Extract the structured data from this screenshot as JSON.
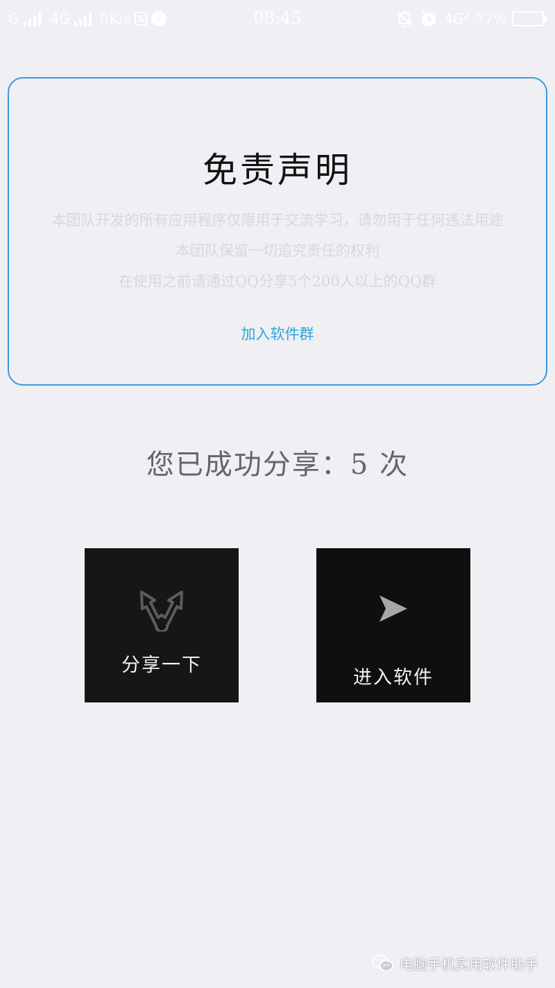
{
  "status_bar": {
    "left_network_1": "G",
    "left_network_2": "4G",
    "net_speed": "0K/s",
    "time": "08:45",
    "right_network": "4G",
    "right_network_sub": "2",
    "battery_percent": "77%",
    "battery_level": 0.77,
    "icons": [
      "signal-icon",
      "signal-icon",
      "sim-s-icon",
      "check-circle-icon",
      "bell-off-icon",
      "alarm-icon",
      "battery-icon"
    ]
  },
  "disclaimer": {
    "title": "免责声明",
    "lines": [
      "本团队开发的所有应用程序仅限用于交流学习，请勿用于任何违法用途",
      "本团队保留一切追究责任的权利",
      "在使用之前请通过QQ分享5个200人以上的QQ群"
    ],
    "join_link": "加入软件群",
    "border_color": "#3c9ad8",
    "link_color": "#2aa7e0"
  },
  "share_status": {
    "text": "您已成功分享：5 次"
  },
  "tiles": {
    "share": {
      "label": "分享一下",
      "icon": "share-arrows-icon"
    },
    "enter": {
      "label": "进入软件",
      "icon": "send-icon"
    }
  },
  "watermark": {
    "text": "电脑手机实用软件助手",
    "icon": "wechat-icon"
  }
}
